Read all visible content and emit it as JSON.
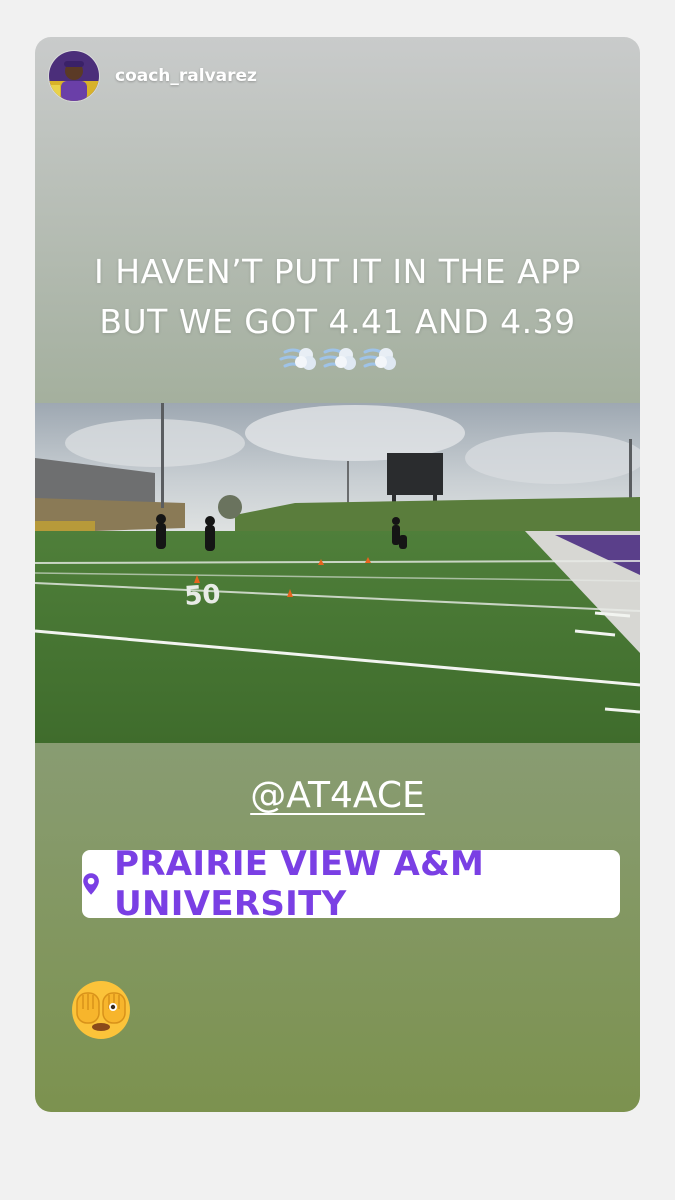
{
  "story": {
    "username": "coach_ralvarez",
    "avatar_icon": "profile-photo",
    "caption_lines": [
      "I HAVEN’T PUT IT IN THE APP",
      "BUT WE GOT 4.41 AND 4.39"
    ],
    "caption_emoji_icon": "dashing-away-emoji",
    "media_description_icon": "football-field-photo",
    "mention": "@AT4ACE",
    "location": {
      "icon": "location-pin-icon",
      "label": "PRAIRIE VIEW A&M UNIVERSITY",
      "color": "#7a3fe4"
    },
    "reaction_icon": "face-with-hands-over-eyes-emoji"
  }
}
